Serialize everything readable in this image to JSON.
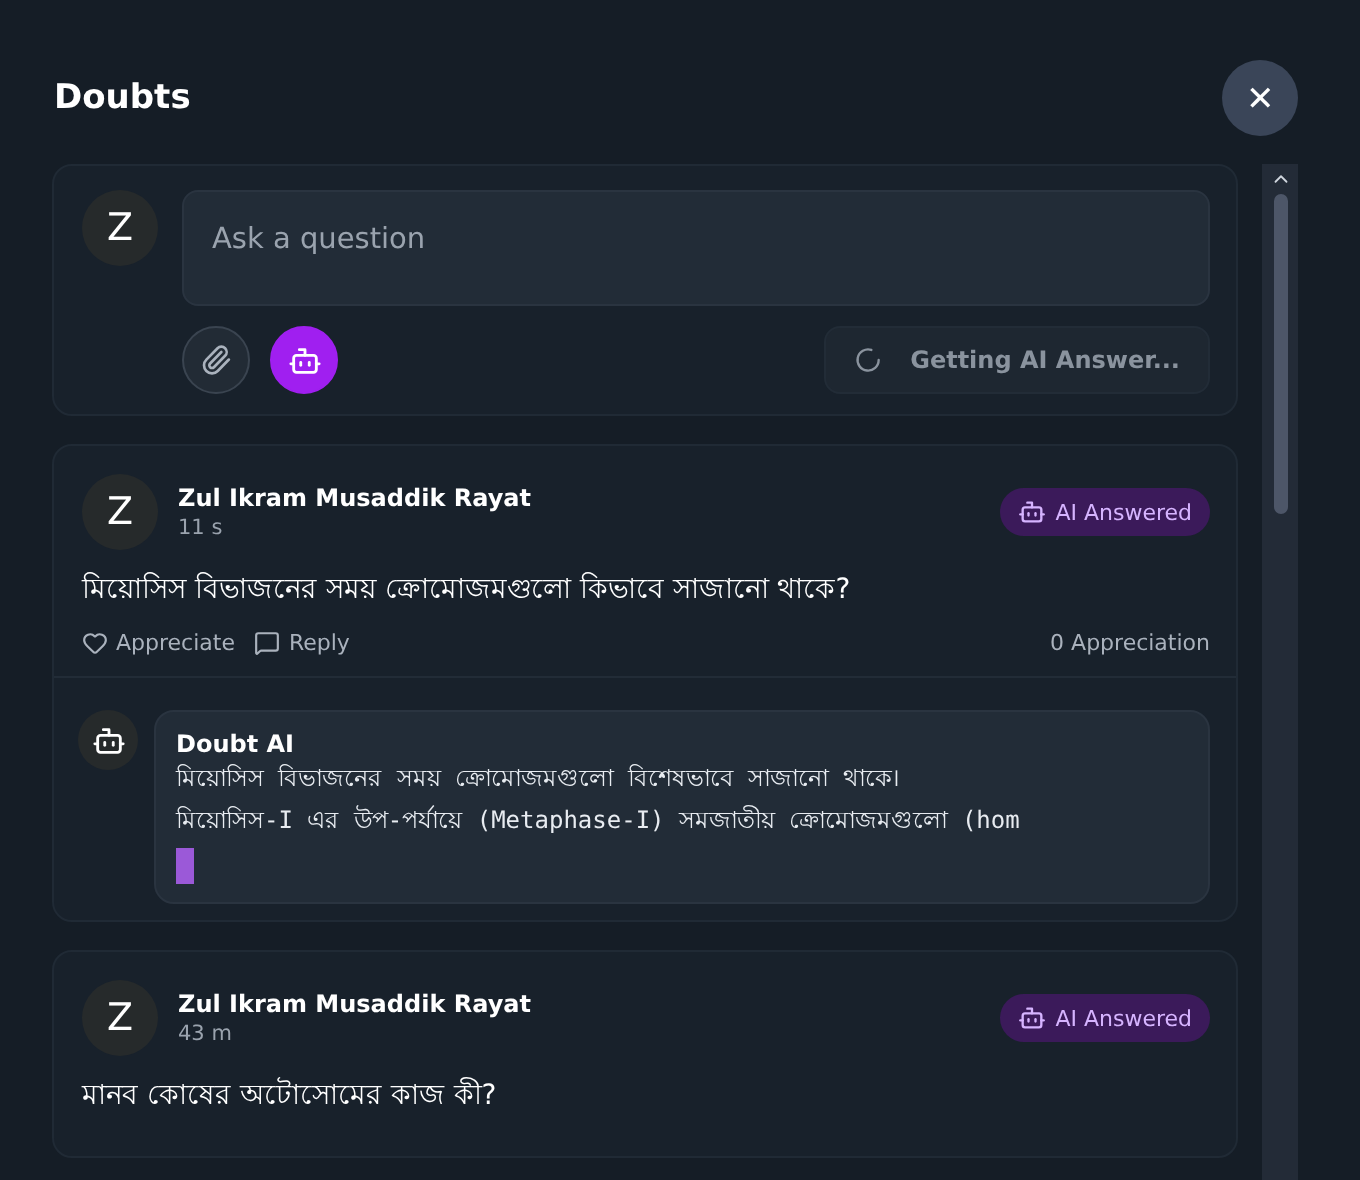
{
  "dialog": {
    "title": "Doubts",
    "close_label": "✕"
  },
  "composer": {
    "avatar": "Z",
    "placeholder": "Ask a question",
    "ai_enabled": true,
    "submit": {
      "label": "Getting AI Answer...",
      "loading": true
    }
  },
  "doubts": [
    {
      "avatar": "Z",
      "author": "Zul Ikram Musaddik Rayat",
      "time": "11 s",
      "badge": "AI Answered",
      "question": "মিয়োসিস বিভাজনের সময় ক্রোমোজমগুলো কিভাবে সাজানো থাকে?",
      "appreciate": "Appreciate",
      "reply": "Reply",
      "appreciation_count": "0 Appreciation",
      "ai_answer": {
        "name": "Doubt AI",
        "lines": [
          "মিয়োসিস বিভাজনের সময় ক্রোমোজমগুলো বিশেষভাবে সাজানো থাকে।",
          "মিয়োসিস-I এর উপ-পর্যায়ে (Metaphase-I) সমজাতীয় ক্রোমোজমগুলো (hom"
        ],
        "streaming": true
      }
    },
    {
      "avatar": "Z",
      "author": "Zul Ikram Musaddik Rayat",
      "time": "43 m",
      "badge": "AI Answered",
      "question": "মানব কোষের অটোসোমের কাজ কী?"
    }
  ]
}
